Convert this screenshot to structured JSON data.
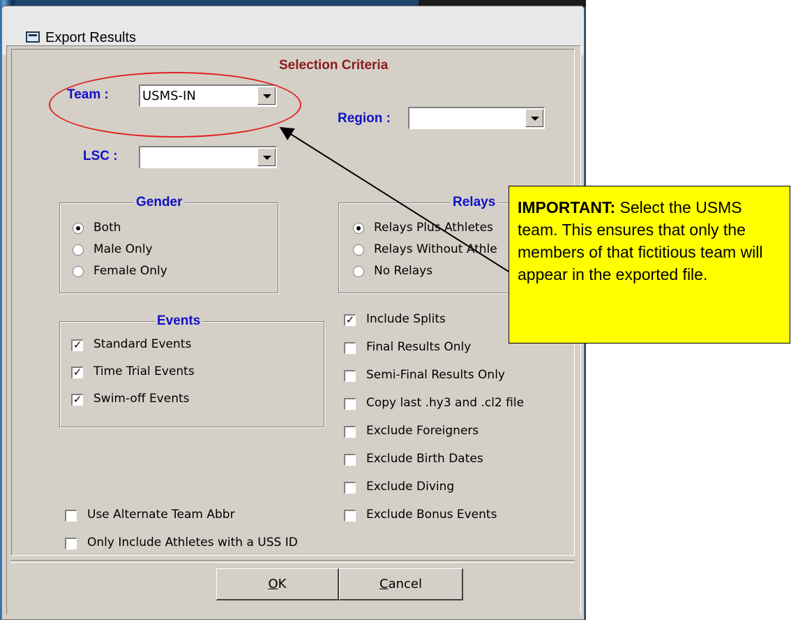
{
  "window": {
    "title": "Export Results",
    "icon": "window-app-icon"
  },
  "selection": {
    "header": "Selection Criteria",
    "team_label": "Team :",
    "team_value": "USMS-IN",
    "region_label": "Region :",
    "region_value": "",
    "lsc_label": "LSC :",
    "lsc_value": ""
  },
  "gender": {
    "title": "Gender",
    "options": [
      "Both",
      "Male Only",
      "Female Only"
    ],
    "selected": "Both"
  },
  "relays": {
    "title": "Relays",
    "options": [
      "Relays Plus Athletes",
      "Relays Without Athle",
      "No Relays"
    ],
    "selected": "Relays Plus Athletes"
  },
  "events": {
    "title": "Events",
    "items": [
      {
        "label": "Standard Events",
        "checked": true
      },
      {
        "label": "Time Trial Events",
        "checked": true
      },
      {
        "label": "Swim-off Events",
        "checked": true
      }
    ]
  },
  "options": {
    "items": [
      {
        "label": "Include Splits",
        "checked": true
      },
      {
        "label": "Final Results Only",
        "checked": false
      },
      {
        "label": "Semi-Final Results Only",
        "checked": false
      },
      {
        "label": "Copy last .hy3 and .cl2 file",
        "checked": false
      },
      {
        "label": "Exclude Foreigners",
        "checked": false
      },
      {
        "label": "Exclude Birth Dates",
        "checked": false
      },
      {
        "label": "Exclude Diving",
        "checked": false
      },
      {
        "label": "Exclude Bonus Events",
        "checked": false
      }
    ]
  },
  "left_options": {
    "items": [
      {
        "label": "Use Alternate Team Abbr",
        "checked": false
      },
      {
        "label": "Only Include Athletes with a USS ID",
        "checked": false
      }
    ]
  },
  "buttons": {
    "ok": "OK",
    "cancel": "Cancel"
  },
  "callout": {
    "lead": "IMPORTANT:",
    "text": " Select the USMS team.  This ensures that only the members of that fictitious team will appear in the exported file."
  },
  "colors": {
    "annotation_red": "#e02020",
    "callout_yellow": "#ffff00",
    "header_red": "#8b1a1a",
    "header_blue": "#1010c8"
  }
}
